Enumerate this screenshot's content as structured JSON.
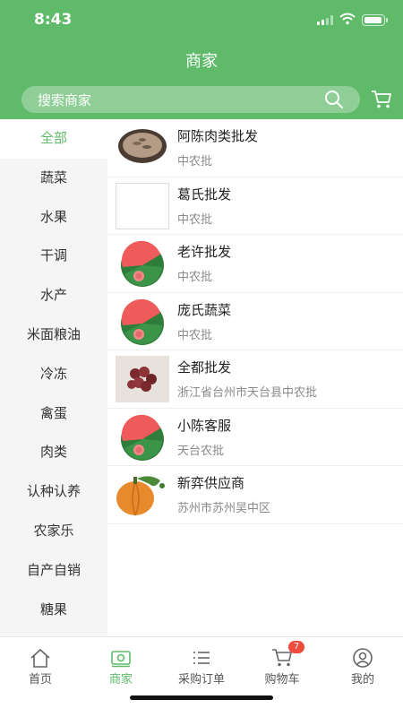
{
  "status_bar": {
    "time": "8:43"
  },
  "header": {
    "title": "商家"
  },
  "search": {
    "placeholder": "搜索商家",
    "icon": "search-icon",
    "cart_icon": "cart-icon"
  },
  "colors": {
    "accent": "#5fba6a",
    "badge": "#f04c3d"
  },
  "sidebar": {
    "active_index": 0,
    "items": [
      {
        "label": "全部"
      },
      {
        "label": "蔬菜"
      },
      {
        "label": "水果"
      },
      {
        "label": "干调"
      },
      {
        "label": "水产"
      },
      {
        "label": "米面粮油"
      },
      {
        "label": "冷冻"
      },
      {
        "label": "禽蛋"
      },
      {
        "label": "肉类"
      },
      {
        "label": "认种认养"
      },
      {
        "label": "农家乐"
      },
      {
        "label": "自产自销"
      },
      {
        "label": "糖果"
      }
    ]
  },
  "merchants": [
    {
      "name": "阿陈肉类批发",
      "location": "中农批",
      "thumb": "seeds"
    },
    {
      "name": "葛氏批发",
      "location": "中农批",
      "thumb": "blank"
    },
    {
      "name": "老许批发",
      "location": "中农批",
      "thumb": "watermelon"
    },
    {
      "name": "庞氏蔬菜",
      "location": "中农批",
      "thumb": "watermelon"
    },
    {
      "name": "全都批发",
      "location": "浙江省台州市天台县中农批",
      "thumb": "grapes"
    },
    {
      "name": "小陈客服",
      "location": "天台农批",
      "thumb": "watermelon"
    },
    {
      "name": "新弈供应商",
      "location": "苏州市苏州吴中区",
      "thumb": "pumpkin"
    }
  ],
  "tabbar": {
    "active_index": 1,
    "items": [
      {
        "label": "首页",
        "icon": "home-icon"
      },
      {
        "label": "商家",
        "icon": "shop-icon"
      },
      {
        "label": "采购订单",
        "icon": "list-icon"
      },
      {
        "label": "购物车",
        "icon": "cart-icon",
        "badge": "7"
      },
      {
        "label": "我的",
        "icon": "profile-icon"
      }
    ]
  }
}
